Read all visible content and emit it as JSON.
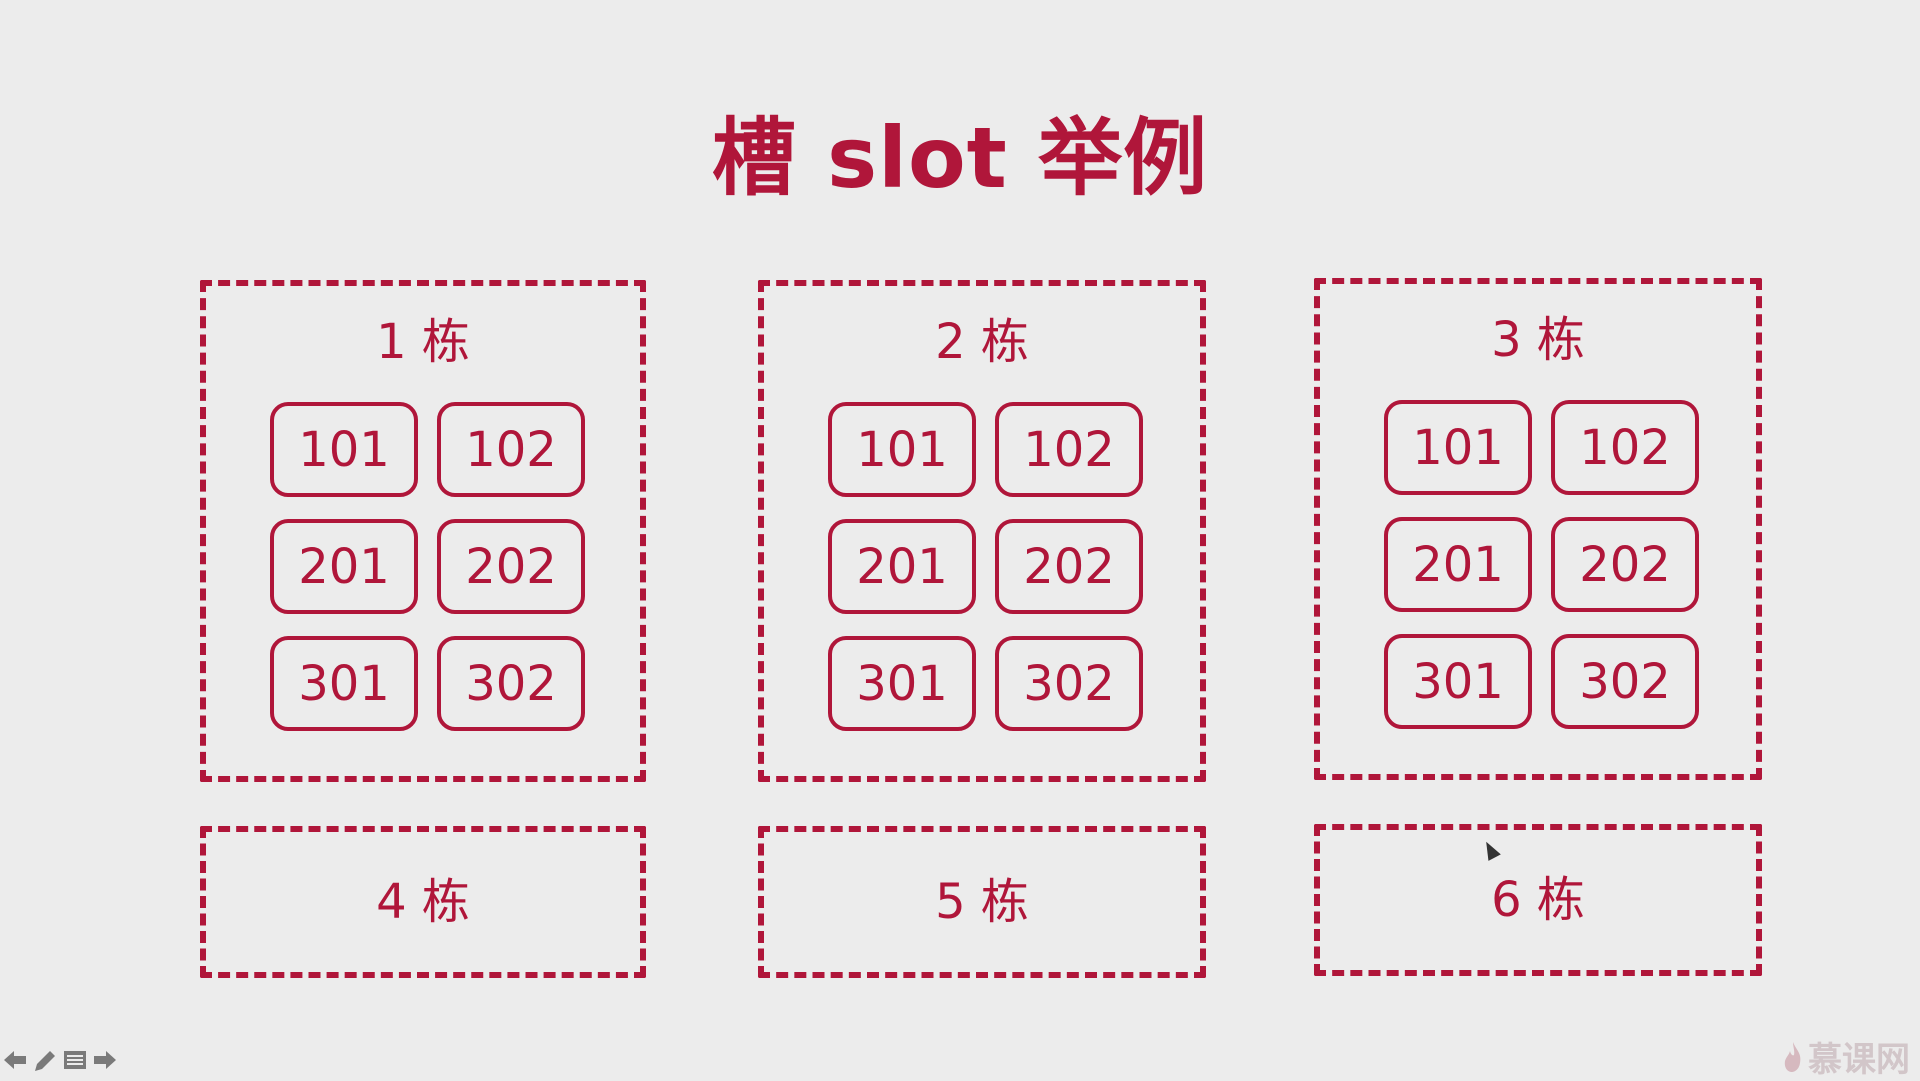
{
  "title": "槽 slot 举例",
  "colors": {
    "accent": "#b0163a",
    "background": "#ececec"
  },
  "buildings": [
    {
      "label": "1 栋",
      "rooms": [
        "101",
        "102",
        "201",
        "202",
        "301",
        "302"
      ]
    },
    {
      "label": "2 栋",
      "rooms": [
        "101",
        "102",
        "201",
        "202",
        "301",
        "302"
      ]
    },
    {
      "label": "3 栋",
      "rooms": [
        "101",
        "102",
        "201",
        "202",
        "301",
        "302"
      ]
    },
    {
      "label": "4 栋",
      "rooms": []
    },
    {
      "label": "5 栋",
      "rooms": []
    },
    {
      "label": "6 栋",
      "rooms": []
    }
  ],
  "toolbar": {
    "icons": [
      "arrow-left-icon",
      "pen-icon",
      "menu-icon",
      "arrow-right-icon"
    ]
  },
  "watermark": {
    "text": "慕课网",
    "icon": "flame-icon"
  }
}
